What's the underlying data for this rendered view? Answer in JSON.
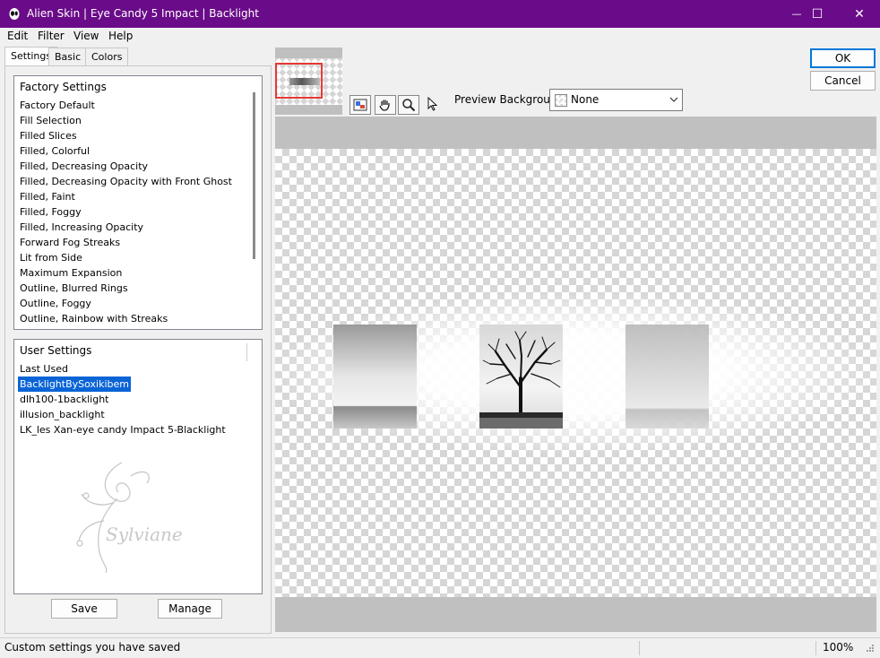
{
  "window": {
    "title": "Alien Skin | Eye Candy 5 Impact | Backlight",
    "minimize_glyph": "—",
    "maximize_glyph": "☐",
    "close_glyph": "✕"
  },
  "menu": [
    "Edit",
    "Filter",
    "View",
    "Help"
  ],
  "tabs": [
    "Settings",
    "Basic",
    "Colors"
  ],
  "factory_settings": {
    "header": "Factory Settings",
    "items": [
      "Factory Default",
      "Fill Selection",
      "Filled Slices",
      "Filled, Colorful",
      "Filled, Decreasing Opacity",
      "Filled, Decreasing Opacity with Front Ghost",
      "Filled, Faint",
      "Filled, Foggy",
      "Filled, Increasing Opacity",
      "Forward Fog Streaks",
      "Lit from Side",
      "Maximum Expansion",
      "Outline, Blurred Rings",
      "Outline, Foggy",
      "Outline, Rainbow with Streaks"
    ]
  },
  "user_settings": {
    "header": "User Settings",
    "items": [
      "Last Used",
      "BacklightBySoxikibem",
      "dlh100-1backlight",
      "illusion_backlight",
      "LK_les Xan-eye candy Impact 5-Blacklight"
    ],
    "selected_index": 1,
    "watermark": "Sylviane"
  },
  "buttons": {
    "save": "Save",
    "manage": "Manage",
    "ok": "OK",
    "cancel": "Cancel"
  },
  "preview": {
    "background_label": "Preview Background:",
    "background_value": "None"
  },
  "status": {
    "text": "Custom settings you have saved",
    "zoom": "100%"
  },
  "colors": {
    "titlebar": "#6a0b89",
    "selection": "#0a64d6"
  }
}
